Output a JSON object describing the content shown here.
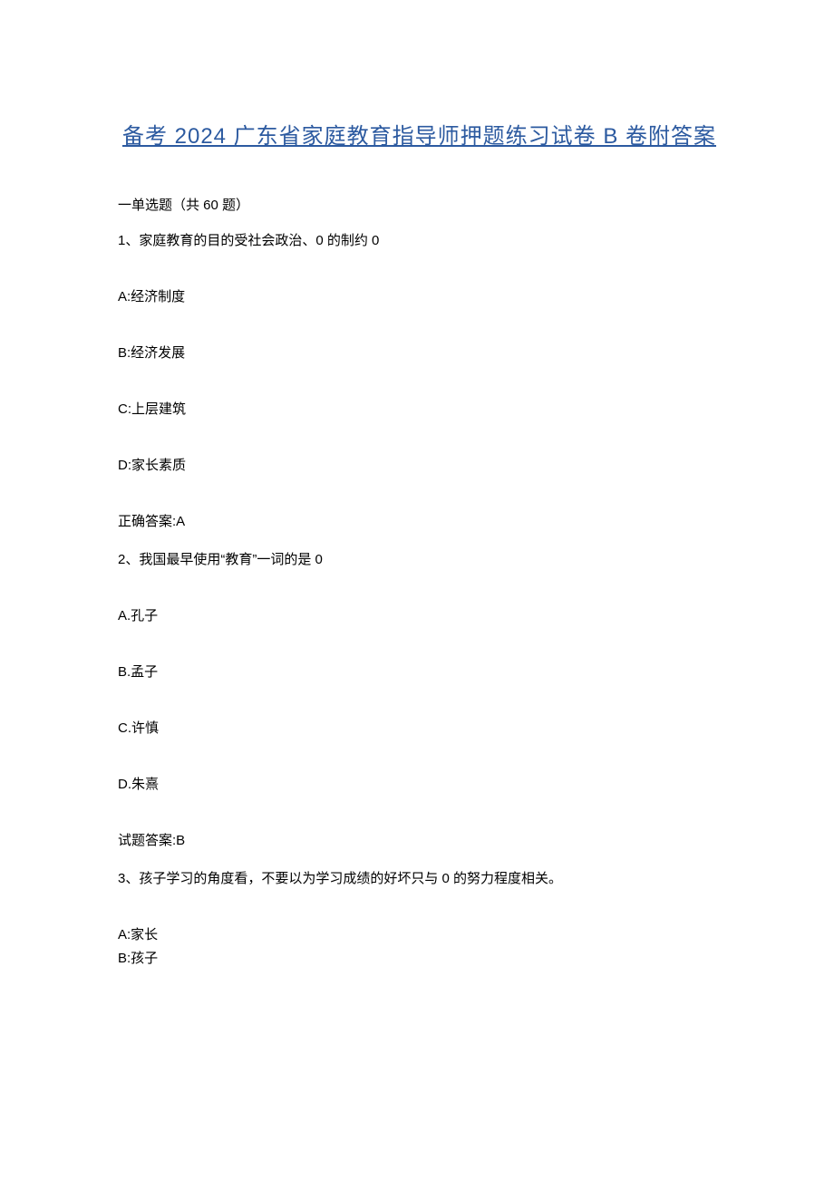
{
  "title": "备考 2024 广东省家庭教育指导师押题练习试卷 B 卷附答案",
  "sectionHeader": "一单选题（共 60 题）",
  "q1": {
    "text": "1、家庭教育的目的受社会政治、0 的制约 0",
    "optA": "A:经济制度",
    "optB": "B:经济发展",
    "optC": "C:上层建筑",
    "optD": "D:家长素质",
    "answer": "正确答案:A"
  },
  "q2": {
    "text": "2、我国最早使用“教育”一词的是 0",
    "optA": "A.孔子",
    "optB": "B.孟子",
    "optC": "C.许慎",
    "optD": "D.朱熹",
    "answer": "试题答案:B"
  },
  "q3": {
    "text": "3、孩子学习的角度看，不要以为学习成绩的好坏只与 0 的努力程度相关。",
    "optA": "A:家长",
    "optB": "B:孩子"
  }
}
